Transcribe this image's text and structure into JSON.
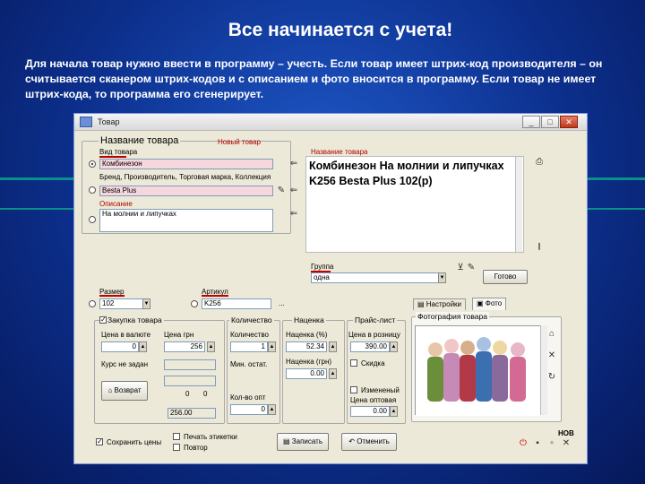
{
  "slide": {
    "title": "Все начинается с учета!",
    "text": "Для начала товар нужно ввести в программу – учесть. Если товар имеет штрих-код производителя – он считывается сканером штрих-кодов и с описанием и фото вносится в программу. Если товар не имеет штрих-кода, то программа его сгенерирует."
  },
  "window": {
    "title": "Товар",
    "minimize": "_",
    "maximize": "□",
    "close": "✕"
  },
  "name_group": {
    "legend": "Название товара",
    "new_label": "Новый товар",
    "type_label": "Вид товара",
    "type_value": "Комбинезон",
    "brand_label": "Бренд, Производитель, Торговая марка, Коллекция",
    "brand_value": "Besta Plus",
    "desc_label": "Описание",
    "desc_value": "На молнии и липучках",
    "full_name_label": "Название товара",
    "full_name_value": "Комбинезон На молнии и липучках K256 Besta Plus 102(р)"
  },
  "group": {
    "label": "Группа",
    "value": "одна",
    "button": "Готово"
  },
  "size": {
    "label": "Размер",
    "value": "102"
  },
  "article": {
    "label": "Артикул",
    "value": "K256",
    "more": "..."
  },
  "purchase": {
    "legend": "Закупка товара",
    "price_currency_label": "Цена в валюте",
    "price_currency_value": "0",
    "price_rub_label": "Цена грн",
    "price_rub_value": "256",
    "rate_label": "Курс не задан",
    "total_value": "256.00",
    "cross_a": "0",
    "cross_b": "0",
    "recalc_button": "Возврат"
  },
  "quantity": {
    "legend": "Количество",
    "qty_label": "Количество",
    "qty_value": "1",
    "min_label": "Мин. остат.",
    "pack_label": "Кол-во опт",
    "pack_value": "0"
  },
  "markup": {
    "legend": "Наценка",
    "pct_label": "Наценка (%)",
    "pct_value": "52.34",
    "abs_label": "Наценка (грн)",
    "abs_value": "0.00"
  },
  "pricelist": {
    "legend": "Прайс-лист",
    "retail_label": "Цена в розницу",
    "retail_value": "390.00",
    "discount_label": "Скидка",
    "changed_label": "Измененый",
    "wholesale_label": "Цена оптовая",
    "wholesale_value": "0.00"
  },
  "tabs": {
    "settings": "Настройки",
    "photo": "Фото",
    "photo_legend": "Фотография товара"
  },
  "bottom": {
    "save_prices": "Сохранить цены",
    "print_label": "Печать этикетки",
    "repeat_label": "Повтор",
    "save_button": "Записать",
    "cancel_button": "Отменить",
    "nov": "НОВ"
  },
  "colors": {
    "bg": "#0c2f8c",
    "window": "#ece9d8",
    "pink_input": "#f7d7de",
    "label_red": "#b00000"
  }
}
